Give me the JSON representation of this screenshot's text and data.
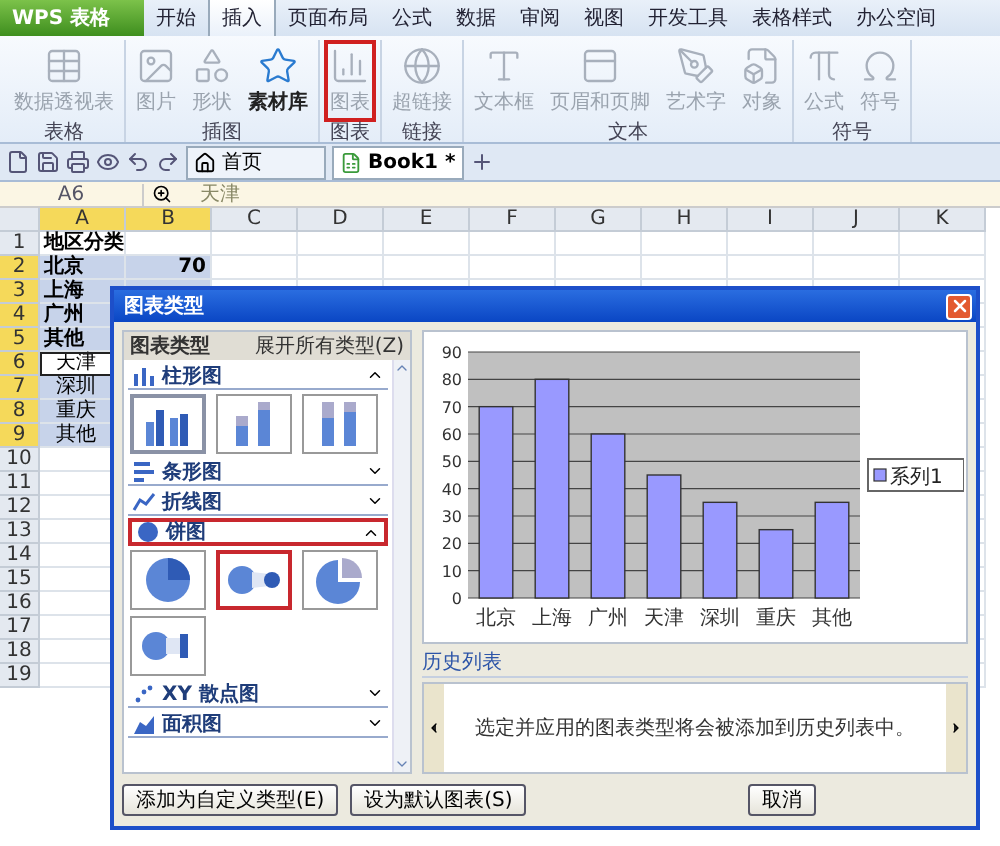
{
  "app_button": "WPS 表格",
  "tabs": [
    {
      "label": "开始",
      "selected": false
    },
    {
      "label": "插入",
      "selected": true
    },
    {
      "label": "页面布局",
      "selected": false
    },
    {
      "label": "公式",
      "selected": false
    },
    {
      "label": "数据",
      "selected": false
    },
    {
      "label": "审阅",
      "selected": false
    },
    {
      "label": "视图",
      "selected": false
    },
    {
      "label": "开发工具",
      "selected": false
    },
    {
      "label": "表格样式",
      "selected": false
    },
    {
      "label": "办公空间",
      "selected": false
    }
  ],
  "ribbon_groups": [
    {
      "label": "表格",
      "items": [
        {
          "label": "数据透视表",
          "disabled": true,
          "highlighted": false
        }
      ]
    },
    {
      "label": "插图",
      "items": [
        {
          "label": "图片",
          "disabled": true,
          "highlighted": false
        },
        {
          "label": "形状",
          "disabled": true,
          "highlighted": false
        },
        {
          "label": "素材库",
          "disabled": false,
          "highlighted": false
        }
      ]
    },
    {
      "label": "图表",
      "items": [
        {
          "label": "图表",
          "disabled": true,
          "highlighted": true
        }
      ]
    },
    {
      "label": "链接",
      "items": [
        {
          "label": "超链接",
          "disabled": true,
          "highlighted": false
        }
      ]
    },
    {
      "label": "文本",
      "items": [
        {
          "label": "文本框",
          "disabled": true,
          "highlighted": false
        },
        {
          "label": "页眉和页脚",
          "disabled": true,
          "highlighted": false
        },
        {
          "label": "艺术字",
          "disabled": true,
          "highlighted": false
        },
        {
          "label": "对象",
          "disabled": true,
          "highlighted": false
        }
      ]
    },
    {
      "label": "符号",
      "items": [
        {
          "label": "公式",
          "disabled": true,
          "highlighted": false
        },
        {
          "label": "符号",
          "disabled": true,
          "highlighted": false
        }
      ]
    }
  ],
  "doc_tabs": [
    {
      "label": "首页",
      "selected": false
    },
    {
      "label": "Book1 *",
      "selected": true
    }
  ],
  "formula_bar": {
    "cell": "A6",
    "value": "天津"
  },
  "sheet": {
    "columns": [
      {
        "label": "A",
        "selected": true
      },
      {
        "label": "B",
        "selected": true
      },
      {
        "label": "C",
        "selected": false
      },
      {
        "label": "D",
        "selected": false
      },
      {
        "label": "E",
        "selected": false
      },
      {
        "label": "F",
        "selected": false
      },
      {
        "label": "G",
        "selected": false
      },
      {
        "label": "H",
        "selected": false
      },
      {
        "label": "I",
        "selected": false
      },
      {
        "label": "J",
        "selected": false
      },
      {
        "label": "K",
        "selected": false
      }
    ],
    "rows": [
      {
        "num": "1",
        "a": "地区分类",
        "b": "",
        "selected": false,
        "active": false
      },
      {
        "num": "2",
        "a": "北京",
        "b": "70",
        "selected": true,
        "active": false
      },
      {
        "num": "3",
        "a": "上海",
        "b": "",
        "selected": true,
        "active": false
      },
      {
        "num": "4",
        "a": "广州",
        "b": "",
        "selected": true,
        "active": false
      },
      {
        "num": "5",
        "a": "其他",
        "b": "",
        "selected": true,
        "active": false
      },
      {
        "num": "6",
        "a": "天津",
        "b": "",
        "selected": true,
        "active": true
      },
      {
        "num": "7",
        "a": "深圳",
        "b": "",
        "selected": true,
        "active": false
      },
      {
        "num": "8",
        "a": "重庆",
        "b": "",
        "selected": true,
        "active": false
      },
      {
        "num": "9",
        "a": "其他",
        "b": "",
        "selected": true,
        "active": false
      },
      {
        "num": "10",
        "a": "",
        "b": "",
        "selected": false,
        "active": false
      },
      {
        "num": "11",
        "a": "",
        "b": "",
        "selected": false,
        "active": false
      },
      {
        "num": "12",
        "a": "",
        "b": "",
        "selected": false,
        "active": false
      },
      {
        "num": "13",
        "a": "",
        "b": "",
        "selected": false,
        "active": false
      },
      {
        "num": "14",
        "a": "",
        "b": "",
        "selected": false,
        "active": false
      },
      {
        "num": "15",
        "a": "",
        "b": "",
        "selected": false,
        "active": false
      },
      {
        "num": "16",
        "a": "",
        "b": "",
        "selected": false,
        "active": false
      },
      {
        "num": "17",
        "a": "",
        "b": "",
        "selected": false,
        "active": false
      },
      {
        "num": "18",
        "a": "",
        "b": "",
        "selected": false,
        "active": false
      },
      {
        "num": "19",
        "a": "",
        "b": "",
        "selected": false,
        "active": false
      }
    ]
  },
  "dialog": {
    "title": "图表类型",
    "panel_title": "图表类型",
    "expand_all": "展开所有类型(Z)",
    "sections": [
      {
        "kind": "column",
        "label": "柱形图",
        "expanded": true,
        "highlighted": false,
        "thumbs": [
          {
            "kind": "clustered",
            "selected": true
          },
          {
            "kind": "stacked",
            "selected": false
          },
          {
            "kind": "percent",
            "selected": false
          }
        ]
      },
      {
        "kind": "bar",
        "label": "条形图",
        "expanded": false,
        "highlighted": false
      },
      {
        "kind": "line",
        "label": "折线图",
        "expanded": false,
        "highlighted": false
      },
      {
        "kind": "pie",
        "label": "饼图",
        "expanded": true,
        "highlighted": true,
        "thumbs": [
          {
            "kind": "pie",
            "selected": false
          },
          {
            "kind": "pie-of-pie",
            "selected": true
          },
          {
            "kind": "exploded",
            "selected": false
          },
          {
            "kind": "bar-of-pie",
            "selected": false
          }
        ]
      },
      {
        "kind": "scatter",
        "label": "XY 散点图",
        "expanded": false,
        "highlighted": false
      },
      {
        "kind": "area",
        "label": "面积图",
        "expanded": false,
        "highlighted": false
      }
    ],
    "chart_data": {
      "type": "bar",
      "grid": true,
      "categories": [
        "北京",
        "上海",
        "广州",
        "天津",
        "深圳",
        "重庆",
        "其他"
      ],
      "series": [
        {
          "name": "系列1",
          "color": "#9999ff",
          "values": [
            70,
            80,
            60,
            45,
            35,
            25,
            35
          ]
        }
      ],
      "ylim": [
        0,
        90
      ],
      "yticks": [
        0,
        10,
        20,
        30,
        40,
        50,
        60,
        70,
        80,
        90
      ]
    },
    "history_label": "历史列表",
    "history_text": "选定并应用的图表类型将会被添加到历史列表中。",
    "buttons": [
      "添加为自定义类型(E)",
      "设为默认图表(S)",
      "取消"
    ]
  }
}
